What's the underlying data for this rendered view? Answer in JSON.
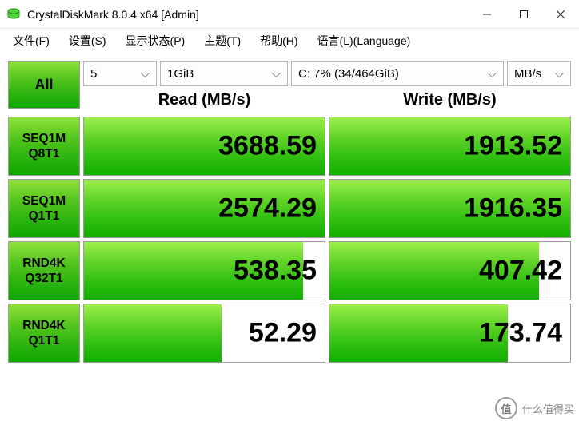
{
  "window": {
    "title": "CrystalDiskMark 8.0.4 x64 [Admin]"
  },
  "menu": {
    "file": "文件(F)",
    "settings": "设置(S)",
    "state": "显示状态(P)",
    "theme": "主题(T)",
    "help": "帮助(H)",
    "language": "语言(L)(Language)"
  },
  "controls": {
    "all_label": "All",
    "runs": "5",
    "size": "1GiB",
    "drive": "C: 7% (34/464GiB)",
    "unit": "MB/s"
  },
  "headers": {
    "read": "Read (MB/s)",
    "write": "Write (MB/s)"
  },
  "tests": [
    {
      "label1": "SEQ1M",
      "label2": "Q8T1",
      "read": {
        "value": "3688.59",
        "pct": 100
      },
      "write": {
        "value": "1913.52",
        "pct": 100
      }
    },
    {
      "label1": "SEQ1M",
      "label2": "Q1T1",
      "read": {
        "value": "2574.29",
        "pct": 100
      },
      "write": {
        "value": "1916.35",
        "pct": 100
      }
    },
    {
      "label1": "RND4K",
      "label2": "Q32T1",
      "read": {
        "value": "538.35",
        "pct": 91
      },
      "write": {
        "value": "407.42",
        "pct": 87
      }
    },
    {
      "label1": "RND4K",
      "label2": "Q1T1",
      "read": {
        "value": "52.29",
        "pct": 57
      },
      "write": {
        "value": "173.74",
        "pct": 74
      }
    }
  ],
  "watermark": "什么值得买"
}
